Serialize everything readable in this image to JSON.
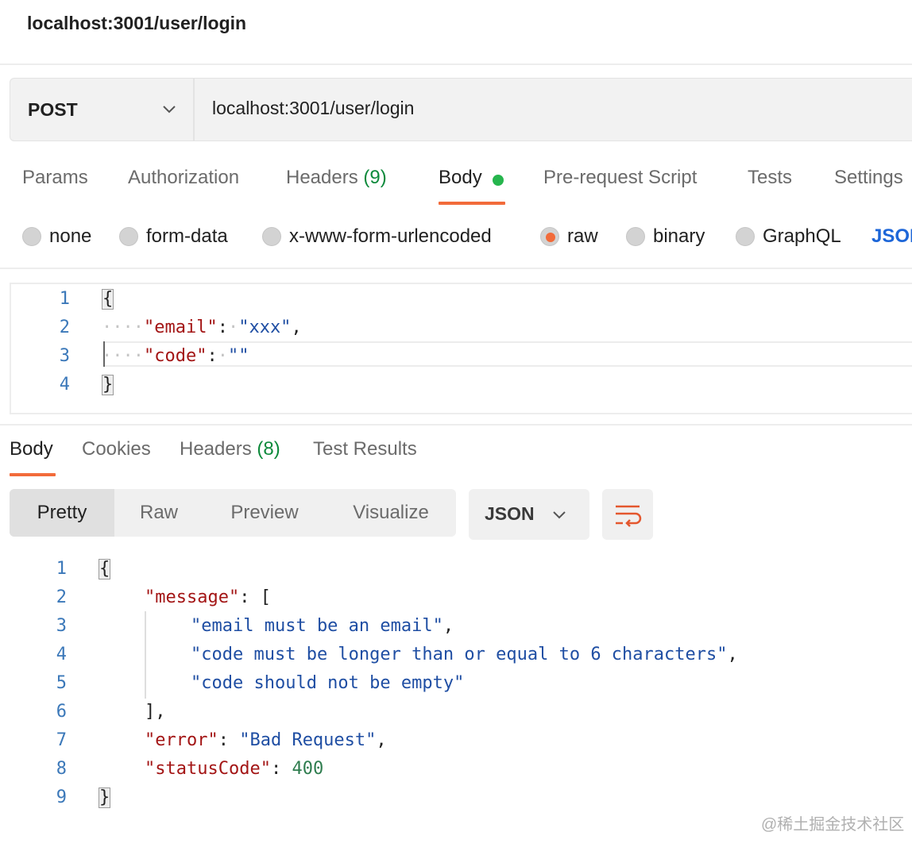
{
  "title": "localhost:3001/user/login",
  "request": {
    "method": "POST",
    "url": "localhost:3001/user/login"
  },
  "request_tabs": {
    "params": "Params",
    "authorization": "Authorization",
    "headers": "Headers",
    "headers_count": "(9)",
    "body": "Body",
    "prerequest": "Pre-request Script",
    "tests": "Tests",
    "settings": "Settings"
  },
  "body_types": {
    "none": "none",
    "form_data": "form-data",
    "urlencoded": "x-www-form-urlencoded",
    "raw": "raw",
    "binary": "binary",
    "graphql": "GraphQL",
    "format": "JSON",
    "selected": "raw"
  },
  "request_body": {
    "line_numbers": [
      "1",
      "2",
      "3",
      "4"
    ],
    "open_brace": "{",
    "close_brace": "}",
    "email_key": "\"email\"",
    "email_value": "\"xxx\"",
    "code_key": "\"code\"",
    "code_value": "\"\""
  },
  "response_tabs": {
    "body": "Body",
    "cookies": "Cookies",
    "headers": "Headers",
    "headers_count": "(8)",
    "test_results": "Test Results"
  },
  "response_view": {
    "pretty": "Pretty",
    "raw": "Raw",
    "preview": "Preview",
    "visualize": "Visualize",
    "format": "JSON"
  },
  "response_body": {
    "line_numbers": [
      "1",
      "2",
      "3",
      "4",
      "5",
      "6",
      "7",
      "8",
      "9"
    ],
    "open_brace": "{",
    "close_brace": "}",
    "message_key": "\"message\"",
    "open_bracket": "[",
    "messages": [
      "\"email must be an email\"",
      "\"code must be longer than or equal to 6 characters\"",
      "\"code should not be empty\""
    ],
    "close_bracket": "],",
    "error_key": "\"error\"",
    "error_value": "\"Bad Request\"",
    "status_key": "\"statusCode\"",
    "status_value": "400"
  },
  "watermark": "@稀土掘金技术社区",
  "colors": {
    "accent": "#f26b3a",
    "body_dot": "#26b54d",
    "count_green": "#0e8a3c",
    "json_key": "#a31515",
    "json_string": "#1f4ea3",
    "json_number": "#2f7d4f",
    "line_number": "#3b78b9",
    "link_blue": "#1d66d8"
  },
  "icons": {
    "method_dropdown": "chevron-down-icon",
    "format_dropdown": "chevron-down-icon",
    "wrap": "wrap-lines-icon",
    "body_indicator": "status-dot-icon"
  }
}
